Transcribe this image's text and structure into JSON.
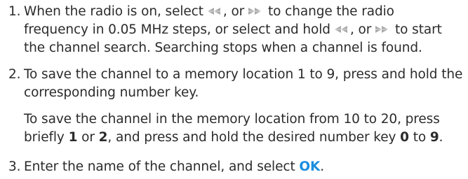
{
  "steps": [
    {
      "number": "1.",
      "line1_a": "When the radio is on, select",
      "line1_b": ", or",
      "line1_c": "to change the radio",
      "line2": "frequency in 0.05 MHz steps, or select and hold",
      "line2_b": ", or",
      "line2_c": "to start",
      "line3": "the channel search. Searching stops when a channel is found."
    },
    {
      "number": "2.",
      "line1": "To save the channel to a memory location 1 to 9, press and hold the",
      "line2": "corresponding number key.",
      "sub1": "To save the channel in the memory location from 10 to 20, press",
      "sub2_a": "briefly",
      "sub2_k1": "1",
      "sub2_or": "or",
      "sub2_k2": "2",
      "sub2_b": ", and press and hold the desired number key",
      "sub2_k3": "0",
      "sub2_to": "to",
      "sub2_k4": "9",
      "sub2_end": "."
    },
    {
      "number": "3.",
      "line1_a": "Enter the name of the channel, and select",
      "ok": "OK",
      "line1_end": "."
    }
  ],
  "icons": {
    "left": "rewind-icon",
    "right": "fast-forward-icon",
    "color": "#a9a9a9"
  },
  "colors": {
    "text": "#2b2b2b",
    "accent": "#1a8de0"
  }
}
